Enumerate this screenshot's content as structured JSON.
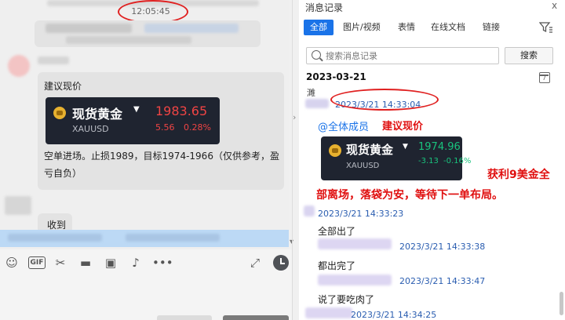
{
  "left_chat": {
    "timestamp": "12:05:45",
    "suggestion": {
      "label": "建议现价",
      "quote": {
        "name": "现货黄金",
        "symbol": "XAUUSD",
        "price": "1983.65",
        "change": "5.56",
        "change_pct": "0.28%",
        "color": "#ef4444"
      },
      "description": "空单进场。止损1989，目标1974-1966（仅供参考，盈亏自负）"
    },
    "reply": "收到"
  },
  "history_panel": {
    "title": "消息记录",
    "close_glyph": "x",
    "tabs": [
      "全部",
      "图片/视频",
      "表情",
      "在线文档",
      "链接"
    ],
    "active_tab": 0,
    "search": {
      "placeholder": "搜索消息记录",
      "button": "搜索"
    },
    "date": "2023-03-21",
    "messages": [
      {
        "time": "2023/3/21 14:33:04",
        "partial_text": "濉"
      },
      {
        "time": "2023/3/21 14:33:23"
      },
      {
        "time": "2023/3/21 14:33:38",
        "text": "全部出了"
      },
      {
        "time": "2023/3/21 14:33:47",
        "text": "都出完了"
      },
      {
        "time": "2023/3/21 14:34:25",
        "text": "说了要吃肉了"
      }
    ],
    "mention": "@全体成员",
    "mention_tail": "建议现价",
    "quote": {
      "name": "现货黄金",
      "symbol": "XAUUSD",
      "price": "1974.96",
      "change": "-3.13",
      "change_pct": "-0.16%",
      "color": "#19c37d"
    },
    "profit_line1": "获利9美金全",
    "profit_line2": "部离场，落袋为安，等待下一单布局。"
  },
  "colors": {
    "accent": "#1a73e8",
    "highlight_red": "#e01010",
    "input_highlight": "#bcd9f5"
  }
}
